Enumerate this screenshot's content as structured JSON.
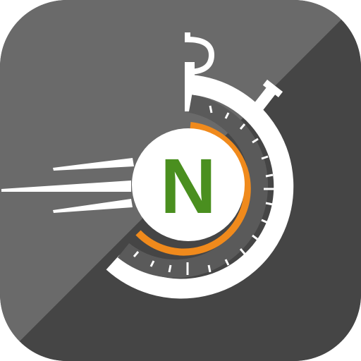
{
  "icon": {
    "name": "stopwatch-speed-n-app-icon",
    "letter": "N",
    "colors": {
      "tile_light": "#6a6a6a",
      "tile_dark": "#454545",
      "white": "#ffffff",
      "orange": "#f08a1c",
      "green": "#4a8f1f",
      "inner_ring": "#5a5a5a"
    }
  }
}
